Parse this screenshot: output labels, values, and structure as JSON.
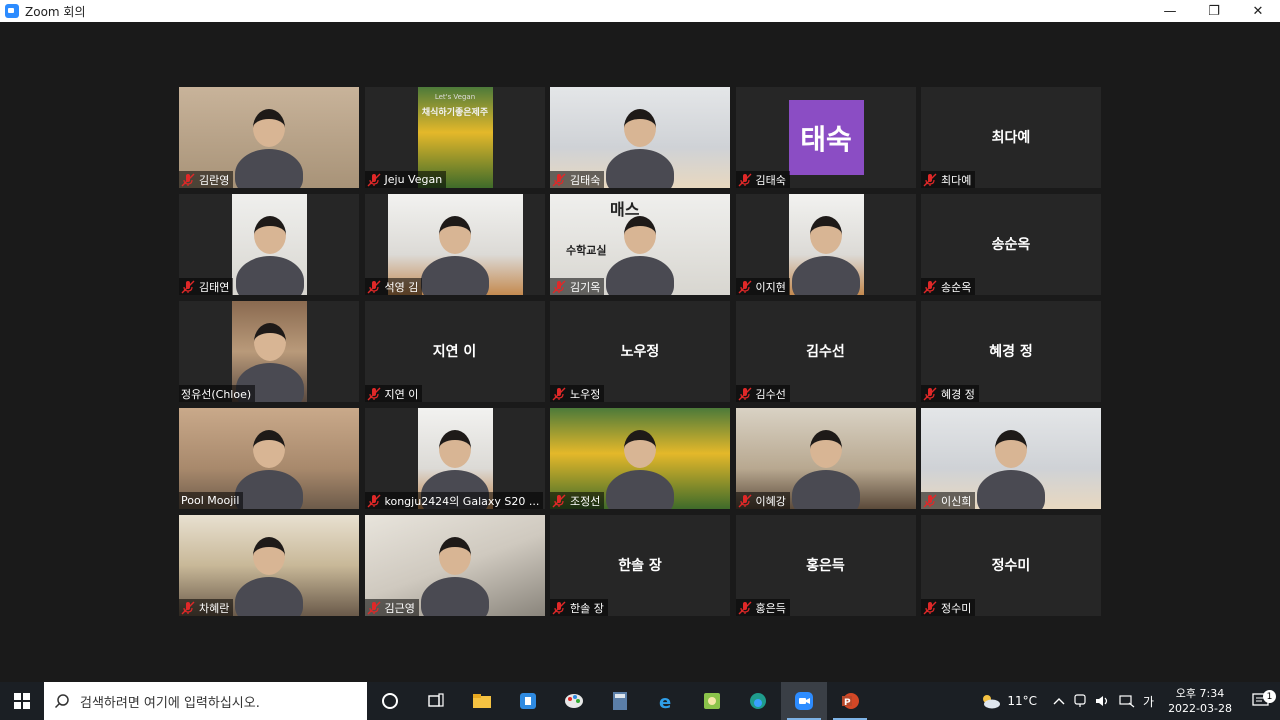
{
  "window": {
    "title": "Zoom 회의",
    "minimize": "—",
    "maximize": "❐",
    "close": "✕"
  },
  "participants": [
    {
      "label": "김란영",
      "type": "video",
      "bg": "photo-bg-f"
    },
    {
      "label": "Jeju Vegan",
      "type": "image",
      "bg": "photo-bg-e"
    },
    {
      "label": "김태숙",
      "type": "video",
      "bg": "photo-bg-g"
    },
    {
      "label": "김태숙",
      "type": "avatar",
      "avatar_text": "태숙",
      "avatar_color": "#8b4dc4"
    },
    {
      "label": "최다예",
      "type": "name",
      "center_name": "최다예"
    },
    {
      "label": "김태연",
      "type": "video",
      "bg": "photo-bg-j"
    },
    {
      "label": "석영 김",
      "type": "video",
      "bg": "photo-bg-d"
    },
    {
      "label": "김기옥",
      "type": "video",
      "bg": "photo-bg-j"
    },
    {
      "label": "이지현",
      "type": "video",
      "bg": "photo-bg-d"
    },
    {
      "label": "송순옥",
      "type": "name",
      "center_name": "송순옥"
    },
    {
      "label": "정유선(Chloe)",
      "type": "video",
      "bg": "photo-bg-h"
    },
    {
      "label": "지연 이",
      "type": "name",
      "center_name": "지연 이"
    },
    {
      "label": "노우정",
      "type": "name",
      "center_name": "노우정"
    },
    {
      "label": "김수선",
      "type": "name",
      "center_name": "김수선"
    },
    {
      "label": "혜경 정",
      "type": "name",
      "center_name": "혜경 정"
    },
    {
      "label": "Pool Moojil",
      "type": "video",
      "bg": "photo-bg-a",
      "active": true
    },
    {
      "label": "kongju2424의 Galaxy S20 ...",
      "type": "video",
      "bg": "photo-bg-d"
    },
    {
      "label": "조정선",
      "type": "video",
      "bg": "photo-bg-e"
    },
    {
      "label": "이혜강",
      "type": "video",
      "bg": "photo-bg-c"
    },
    {
      "label": "이신희",
      "type": "video",
      "bg": "photo-bg-g"
    },
    {
      "label": "차혜란",
      "type": "video",
      "bg": "photo-bg-i"
    },
    {
      "label": "김근영",
      "type": "video",
      "bg": "photo-bg-b"
    },
    {
      "label": "한솔 장",
      "type": "name",
      "center_name": "한솔 장"
    },
    {
      "label": "홍은득",
      "type": "name",
      "center_name": "홍은득"
    },
    {
      "label": "정수미",
      "type": "name",
      "center_name": "정수미"
    }
  ],
  "tile_texts": {
    "jeju_banner": "채식하기좋은제주",
    "jeju_banner_small": "Let's Vegan",
    "math_sign": "수학교실",
    "math_sign_top": "매스"
  },
  "taskbar": {
    "search_placeholder": "검색하려면 여기에 입력하십시오.",
    "weather": "11°C",
    "ime": "가",
    "time": "오후 7:34",
    "date": "2022-03-28",
    "notification_count": "1",
    "apps": [
      "cortana-icon",
      "task-view-icon",
      "file-explorer-icon",
      "store-icon",
      "paint-icon",
      "calculator-icon",
      "ie-icon",
      "notes-icon",
      "edge-icon",
      "zoom-icon",
      "powerpoint-icon"
    ]
  }
}
